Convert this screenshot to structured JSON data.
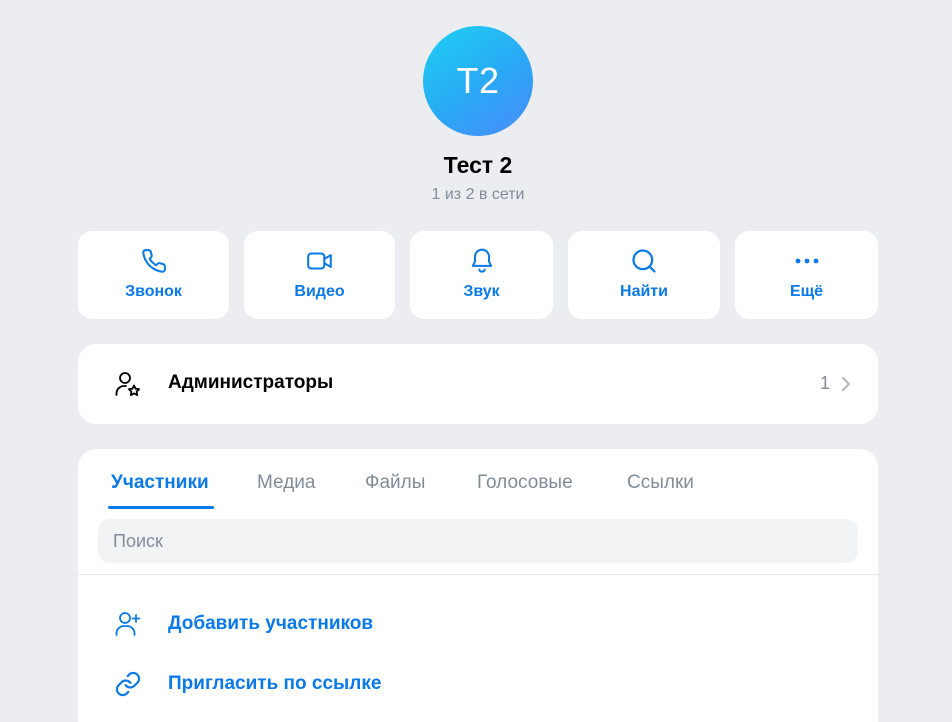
{
  "header": {
    "avatar_initials": "T2",
    "title": "Тест 2",
    "subtitle": "1 из 2 в сети",
    "avatar_gradient": [
      "#1ed1f4",
      "#4b8afa"
    ]
  },
  "actions": [
    {
      "label": "Звонок",
      "icon": "phone-icon"
    },
    {
      "label": "Видео",
      "icon": "video-camera-icon"
    },
    {
      "label": "Звук",
      "icon": "bell-icon"
    },
    {
      "label": "Найти",
      "icon": "search-icon"
    },
    {
      "label": "Ещё",
      "icon": "more-dots-icon"
    }
  ],
  "admins": {
    "label": "Администраторы",
    "count": "1",
    "icon": "user-star-icon"
  },
  "members": {
    "tabs": [
      {
        "label": "Участники",
        "active": true
      },
      {
        "label": "Медиа",
        "active": false
      },
      {
        "label": "Файлы",
        "active": false
      },
      {
        "label": "Голосовые",
        "active": false
      },
      {
        "label": "Ссылки",
        "active": false
      }
    ],
    "search_placeholder": "Поиск",
    "rows": [
      {
        "label": "Добавить участников",
        "icon": "add-user-icon"
      },
      {
        "label": "Пригласить по ссылке",
        "icon": "link-icon"
      }
    ]
  },
  "colors": {
    "accent": "#0a7aea",
    "background": "#ebedf0",
    "secondary_text": "#818c99"
  }
}
